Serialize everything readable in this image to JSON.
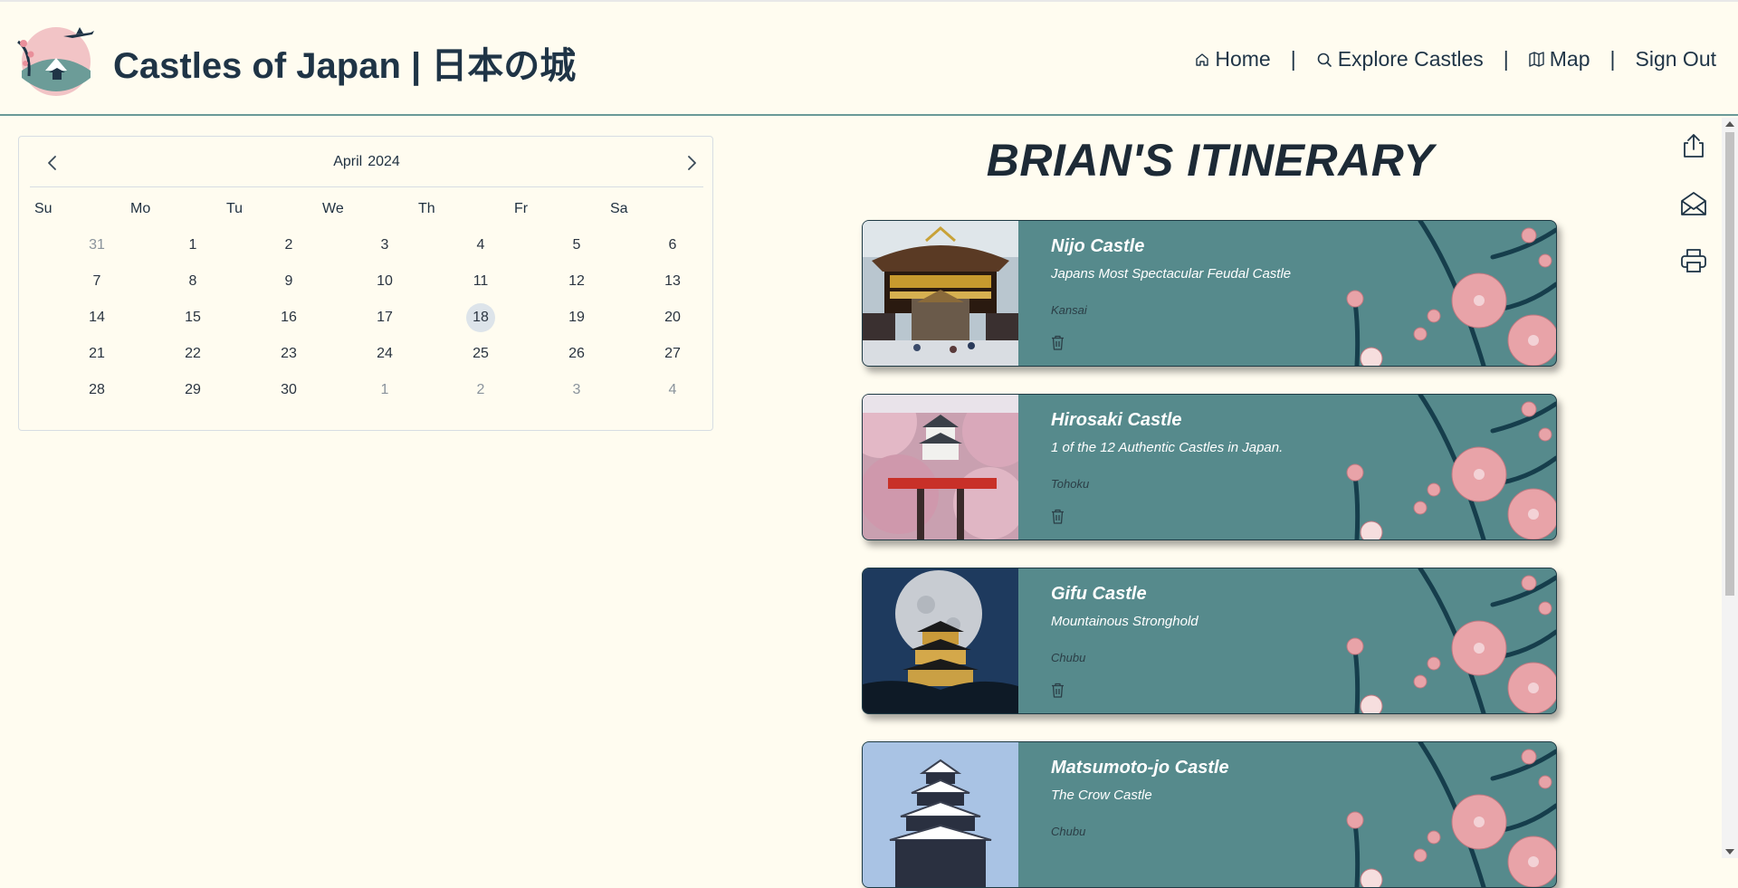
{
  "header": {
    "title": "Castles of Japan | 日本の城",
    "nav": [
      {
        "label": "Home",
        "icon": "home-icon"
      },
      {
        "label": "Explore Castles",
        "icon": "search-icon"
      },
      {
        "label": "Map",
        "icon": "map-icon"
      },
      {
        "label": "Sign Out"
      }
    ],
    "separator": "|"
  },
  "calendar": {
    "month": "April",
    "year": "2024",
    "weekdays": [
      "Su",
      "Mo",
      "Tu",
      "We",
      "Th",
      "Fr",
      "Sa"
    ],
    "days": [
      "31",
      "1",
      "2",
      "3",
      "4",
      "5",
      "6",
      "7",
      "8",
      "9",
      "10",
      "11",
      "12",
      "13",
      "14",
      "15",
      "16",
      "17",
      "18",
      "19",
      "20",
      "21",
      "22",
      "23",
      "24",
      "25",
      "26",
      "27",
      "28",
      "29",
      "30",
      "1",
      "2",
      "3",
      "4"
    ],
    "selected_day": "18"
  },
  "itinerary": {
    "title": "BRIAN'S ITINERARY",
    "cards": [
      {
        "name": "Nijo Castle",
        "tagline": "Japans Most Spectacular Feudal Castle",
        "region": "Kansai"
      },
      {
        "name": "Hirosaki Castle",
        "tagline": "1 of the 12 Authentic Castles in Japan.",
        "region": "Tohoku"
      },
      {
        "name": "Gifu Castle",
        "tagline": "Mountainous Stronghold",
        "region": "Chubu"
      },
      {
        "name": "Matsumoto-jo Castle",
        "tagline": "The Crow Castle",
        "region": "Chubu"
      }
    ]
  },
  "actions": [
    "share-icon",
    "email-icon",
    "print-icon"
  ],
  "colors": {
    "background": "#fffcf0",
    "card": "#568a8c",
    "header_border": "#6a9a98",
    "blossom": "#e8a3a8",
    "branch": "#143c4c"
  }
}
